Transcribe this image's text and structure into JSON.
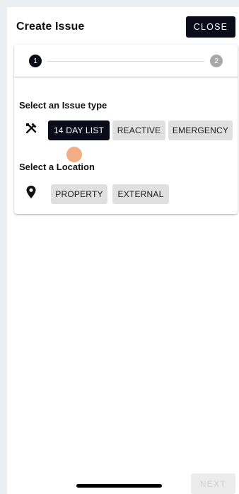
{
  "header": {
    "title": "Create Issue",
    "close_label": "CLOSE"
  },
  "stepper": {
    "steps": [
      {
        "label": "1",
        "state": "active"
      },
      {
        "label": "2",
        "state": "inactive"
      }
    ]
  },
  "issue_type": {
    "label": "Select an Issue type",
    "icon": "tools-icon",
    "options": [
      "14 DAY LIST",
      "REACTIVE",
      "EMERGENCY"
    ],
    "selected": "14 DAY LIST"
  },
  "location": {
    "label": "Select a Location",
    "icon": "location-pin-icon",
    "options": [
      "PROPERTY",
      "EXTERNAL"
    ],
    "selected": null
  },
  "footer": {
    "next_label": "NEXT"
  },
  "colors": {
    "primary": "#0b0b1a",
    "chip_bg": "#e0e0e0",
    "page_bg": "#ebeef3",
    "ripple": "#ec8a50"
  }
}
